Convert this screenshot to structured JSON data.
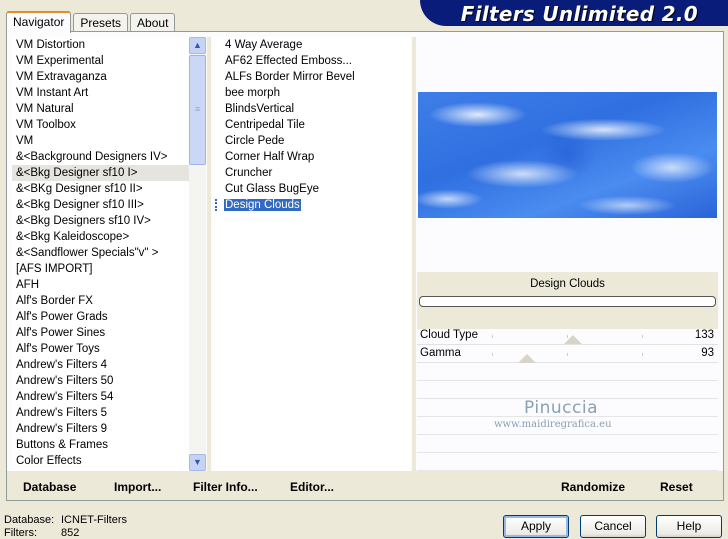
{
  "tabs": [
    "Navigator",
    "Presets",
    "About"
  ],
  "banner_title": "Filters Unlimited 2.0",
  "categories": [
    "VM Distortion",
    "VM Experimental",
    "VM Extravaganza",
    "VM Instant Art",
    "VM Natural",
    "VM Toolbox",
    "VM",
    "&<Background Designers IV>",
    "&<Bkg Designer sf10 I>",
    "&<BKg Designer sf10 II>",
    "&<Bkg Designer sf10 III>",
    "&<Bkg Designers sf10 IV>",
    "&<Bkg Kaleidoscope>",
    "&<Sandflower Specials\"v\" >",
    "[AFS IMPORT]",
    "AFH",
    "Alf's Border FX",
    "Alf's Power Grads",
    "Alf's Power Sines",
    "Alf's Power Toys",
    "Andrew's Filters 4",
    "Andrew's Filters 50",
    "Andrew's Filters 54",
    "Andrew's Filters 5",
    "Andrew's Filters 9",
    "Buttons & Frames",
    "Color Effects"
  ],
  "selected_category": "&<Bkg Designer sf10 I>",
  "filters": [
    "4 Way Average",
    "AF62 Effected Emboss...",
    "ALFs Border Mirror Bevel",
    "bee morph",
    "BlindsVertical",
    "Centripedal Tile",
    "Circle Pede",
    "Corner Half Wrap",
    "Cruncher",
    "Cut Glass  BugEye",
    "Design Clouds"
  ],
  "selected_filter": "Design Clouds",
  "preview": {
    "filter_name": "Design Clouds",
    "progress": 0
  },
  "params": [
    {
      "name": "Cloud Type",
      "value": "133"
    },
    {
      "name": "Gamma",
      "value": "93"
    }
  ],
  "watermark": {
    "name": "Pinuccia",
    "url": "www.maidiregrafica.eu"
  },
  "bottom_buttons": {
    "database": "Database",
    "import": "Import...",
    "filter_info": "Filter Info...",
    "editor": "Editor...",
    "randomize": "Randomize",
    "reset": "Reset"
  },
  "status": {
    "database_label": "Database:",
    "database_value": "ICNET-Filters",
    "filters_label": "Filters:",
    "filters_value": "852"
  },
  "dialog_buttons": {
    "apply": "Apply",
    "cancel": "Cancel",
    "help": "Help"
  },
  "colors": {
    "banner": "#0a1c7a",
    "selection": "#316ac5",
    "face": "#ece9d8"
  }
}
